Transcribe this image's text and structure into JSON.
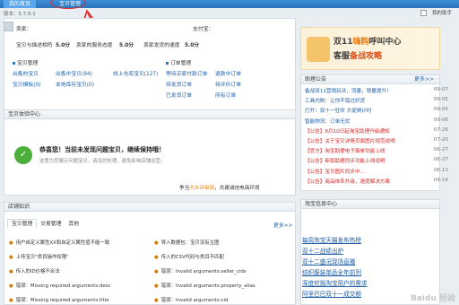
{
  "topbar": {
    "tabs": [
      "我的首页",
      "宝贝管理"
    ]
  },
  "version": "版本：5.7.6.1",
  "sys": {
    "label": "我的助手"
  },
  "account": {
    "name_label": "卖家：",
    "pay_label": "支付宝：",
    "ratings": [
      {
        "label": "宝贝与描述相符",
        "value": "5.0分"
      },
      {
        "label": "卖家的服务态度",
        "value": "5.0分"
      },
      {
        "label": "卖家发货的速度",
        "value": "5.0分"
      }
    ]
  },
  "goods": {
    "title": "宝贝管理",
    "items": [
      "出售的宝贝",
      "仓库中的宝贝",
      "等待上架",
      "出售中宝贝(94)",
      "本地库存宝贝(0)",
      "线上仓库宝贝(127)"
    ],
    "labels": [
      "出售的宝贝",
      "宝贝模板(0)",
      "出售中宝贝(94)",
      "本地库存宝贝(0)",
      "线上仓库宝贝(127)",
      "待上架宝贝"
    ]
  },
  "orders": {
    "title": "订单管理",
    "items": [
      "等待买家付款订单",
      "待发货订单",
      "已发货订单",
      "退款中订单",
      "待评价订单",
      "所有订单"
    ],
    "counts": [
      "(0)",
      "(0)",
      "(0)",
      "(0)",
      "(0)",
      "(0)"
    ]
  },
  "banner": {
    "line1": "双11",
    "highlight": "嗨购",
    "line1b": "呼叫中心",
    "line2": "客服",
    "line2b": "备战攻略"
  },
  "notice": {
    "title": "助理公告",
    "more": "更多>>",
    "items": [
      {
        "t": "备战双11营销玩法，流量，销量提升！",
        "d": "09-07"
      },
      {
        "t": "工具内购：让你不错过好货",
        "d": "09-05"
      },
      {
        "t": "打开：双十一狂欢 大促倒计时",
        "d": "09-05"
      },
      {
        "t": "智能物流：订单无忧",
        "d": "09-06"
      },
      {
        "t": "【公告】8月10日起淘宝助理升级通知",
        "d": "07-26"
      },
      {
        "t": "【公告】关于宝贝详情页面图片规范说明",
        "d": "07-20"
      },
      {
        "t": "【官方】淘宝助理电子面单功能上线",
        "d": "06-27"
      },
      {
        "t": "【公告】新版助理同步功能上线说明",
        "d": "06-27"
      },
      {
        "t": "【公告】宝贝图片同步中...",
        "d": "06-13"
      },
      {
        "t": "【公告】商品体系升级，速度解决方案",
        "d": "04-14"
      }
    ]
  },
  "experience": {
    "title": "宝贝体验中心",
    "headline": "恭喜您！当前未发现问题宝贝，继续保持哦！",
    "desc": "这里为您展示问题宝贝，请及时处理，避免影响店铺运营。",
    "footer_pre": "争当",
    "footer_link": "大众评审员",
    "footer_post": "，共建诚信电商环境"
  },
  "ops": {
    "title": "店铺知识",
    "tabs": [
      "宝贝管理",
      "交易管理",
      "其他"
    ],
    "more": "更多>>",
    "lines_left": [
      "用户自定义属性XX和自定义属性值不能一致",
      "上传宝贝\"类目操作权限\"",
      "传入的ID价格不合法",
      "错误：Missing required arguments:desc",
      "错误：Missing required arguments:title"
    ],
    "lines_right": [
      "导入数据包：宝贝没有主图",
      "传入的CSV代码与类目不匹配",
      "错误：Invalid arguments:seller_cids",
      "错误：Invalid arguments:property_alias",
      "错误：Invalid arguments:cid"
    ]
  },
  "service": {
    "title": "淘宝信息中心",
    "links": [
      "每周淘宝天猫发布热榜",
      "双十二战绩出炉",
      "双十二盛况现场直播",
      "纺织服装单品全年前列",
      "深度挖掘淘宝用户的需求",
      "阿里巴巴双十一成交额"
    ]
  },
  "watermark": "Baidu 经验"
}
